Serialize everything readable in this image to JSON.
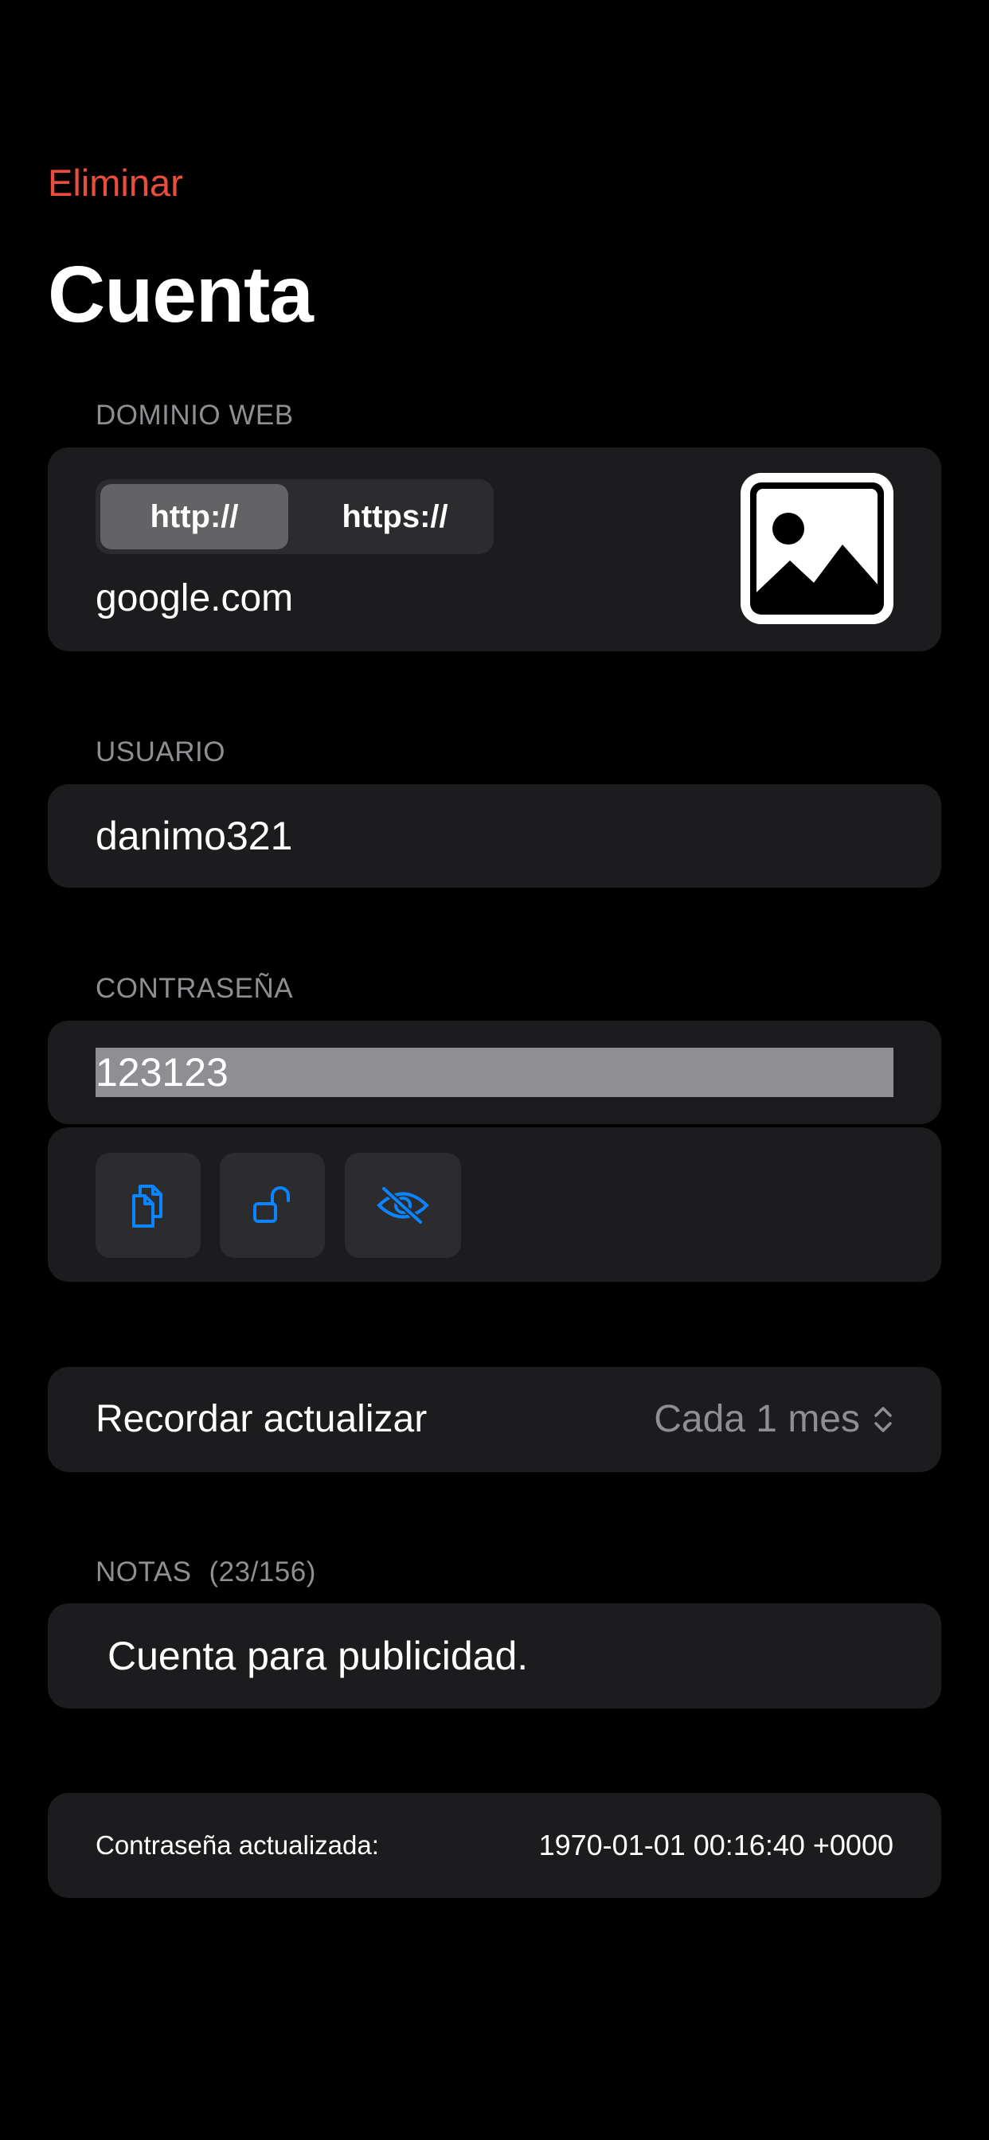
{
  "nav": {
    "delete_label": "Eliminar"
  },
  "title": "Cuenta",
  "domain": {
    "section_label": "DOMINIO WEB",
    "protocols": [
      "http://",
      "https://"
    ],
    "selected_protocol": "http://",
    "value": "google.com",
    "image_icon": "photo-placeholder-icon"
  },
  "user": {
    "section_label": "USUARIO",
    "value": "danimo321"
  },
  "password": {
    "section_label": "CONTRASEÑA",
    "value": "123123",
    "actions": [
      {
        "icon": "copy-documents-icon"
      },
      {
        "icon": "unlock-icon"
      },
      {
        "icon": "eye-slash-icon"
      }
    ],
    "accent_color": "#0a84ff"
  },
  "reminder": {
    "label": "Recordar actualizar",
    "value": "Cada 1 mes",
    "icon": "chevron-up-down-icon"
  },
  "notes": {
    "section_label": "NOTAS",
    "counter": "(23/156)",
    "value": "Cuenta para publicidad."
  },
  "updated": {
    "label": "Contraseña actualizada:",
    "value": "1970-01-01 00:16:40 +0000"
  },
  "colors": {
    "destructive": "#eb4d3d",
    "background": "#000000",
    "card": "#1c1c1e",
    "secondary_text": "#8e8e93"
  }
}
